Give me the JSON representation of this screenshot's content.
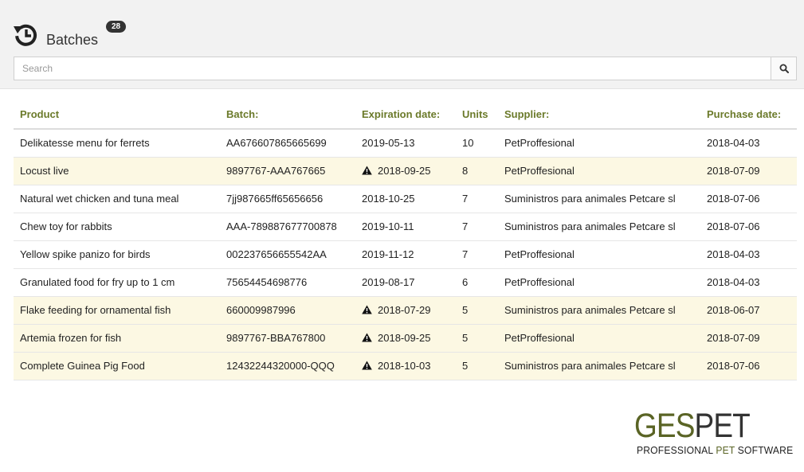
{
  "header": {
    "title": "Batches",
    "count_badge": "28",
    "icon": "history-icon"
  },
  "search": {
    "placeholder": "Search",
    "value": "",
    "icon": "search-icon"
  },
  "table": {
    "columns": [
      "Product",
      "Batch:",
      "Expiration date:",
      "Units",
      "Supplier:",
      "Purchase date:"
    ],
    "rows": [
      {
        "product": "Delikatesse menu for ferrets",
        "batch": "AA676607865665699",
        "expiration": "2019-05-13",
        "units": "10",
        "supplier": "PetProffesional",
        "purchase": "2018-04-03",
        "expiring": false
      },
      {
        "product": "Locust live",
        "batch": "9897767-AAA767665",
        "expiration": "2018-09-25",
        "units": "8",
        "supplier": "PetProffesional",
        "purchase": "2018-07-09",
        "expiring": true
      },
      {
        "product": "Natural wet chicken and tuna meal",
        "batch": "7jj987665ff65656656",
        "expiration": "2018-10-25",
        "units": "7",
        "supplier": "Suministros para animales Petcare sl",
        "purchase": "2018-07-06",
        "expiring": false
      },
      {
        "product": "Chew toy for rabbits",
        "batch": "AAA-789887677700878",
        "expiration": "2019-10-11",
        "units": "7",
        "supplier": "Suministros para animales Petcare sl",
        "purchase": "2018-07-06",
        "expiring": false
      },
      {
        "product": "Yellow spike panizo for birds",
        "batch": "002237656655542AA",
        "expiration": "2019-11-12",
        "units": "7",
        "supplier": "PetProffesional",
        "purchase": "2018-04-03",
        "expiring": false
      },
      {
        "product": "Granulated food for fry up to 1 cm",
        "batch": "75654454698776",
        "expiration": "2019-08-17",
        "units": "6",
        "supplier": "PetProffesional",
        "purchase": "2018-04-03",
        "expiring": false
      },
      {
        "product": "Flake feeding for ornamental fish",
        "batch": "660009987996",
        "expiration": "2018-07-29",
        "units": "5",
        "supplier": "Suministros para animales Petcare sl",
        "purchase": "2018-06-07",
        "expiring": true
      },
      {
        "product": "Artemia frozen for fish",
        "batch": "9897767-BBA767800",
        "expiration": "2018-09-25",
        "units": "5",
        "supplier": "PetProffesional",
        "purchase": "2018-07-09",
        "expiring": true
      },
      {
        "product": "Complete Guinea Pig Food",
        "batch": "12432244320000-QQQ",
        "expiration": "2018-10-03",
        "units": "5",
        "supplier": "Suministros para animales Petcare sl",
        "purchase": "2018-07-06",
        "expiring": true
      }
    ],
    "warning_icon": "warning-triangle-icon"
  },
  "logo": {
    "main_part1": "GES",
    "main_part2": "PET",
    "sub_part1": "PROFESSIONAL ",
    "sub_part2": "PET",
    "sub_part3": " SOFTWARE"
  },
  "colors": {
    "accent": "#6b7a2a",
    "expiring_row": "#fcf8e3",
    "header_bg": "#f2f2f2"
  }
}
